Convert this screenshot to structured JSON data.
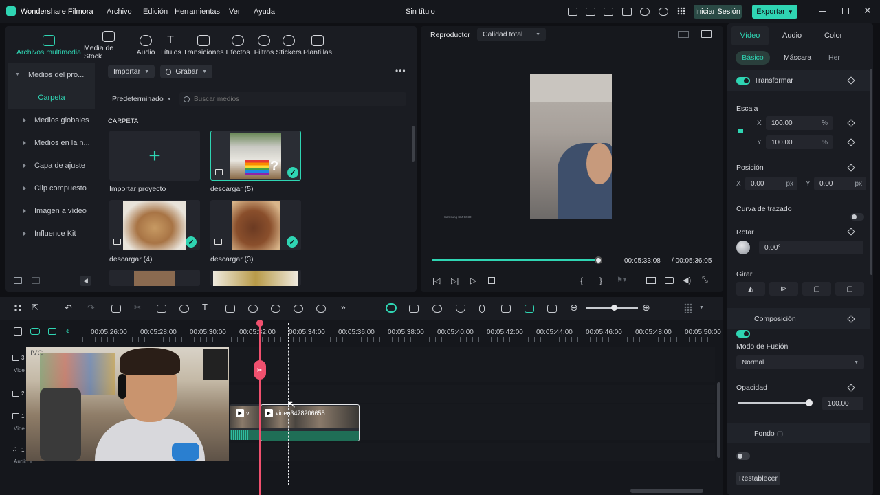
{
  "app": {
    "name": "Wondershare Filmora",
    "doc_title": "Sin título"
  },
  "menu": [
    "Archivo",
    "Edición",
    "Herramientas",
    "Ver",
    "Ayuda"
  ],
  "topbar": {
    "login_label": "Iniciar Sesión",
    "export_label": "Exportar"
  },
  "toolbar": {
    "items": [
      "Archivos multimedia",
      "Media de Stock",
      "Audio",
      "Títulos",
      "Transiciones",
      "Efectos",
      "Filtros",
      "Stickers",
      "Plantillas"
    ],
    "active_index": 0
  },
  "sidebar": {
    "header": "Medios del pro...",
    "folder": "Carpeta",
    "items": [
      "Medios globales",
      "Medios en la n...",
      "Capa de ajuste",
      "Clip compuesto",
      "Imagen a vídeo",
      "Influence Kit"
    ]
  },
  "media": {
    "import_label": "Importar",
    "record_label": "Grabar",
    "sort_label": "Predeterminado",
    "search_placeholder": "Buscar medios",
    "section_label": "CARPETA",
    "import_project_label": "Importar proyecto",
    "items": [
      {
        "name": "descargar (5)",
        "selected": true
      },
      {
        "name": "descargar (4)",
        "selected": false
      },
      {
        "name": "descargar (3)",
        "selected": false
      }
    ]
  },
  "player": {
    "label": "Reproductor",
    "quality": "Calidad total",
    "current_time": "00:05:33:08",
    "total_time": "/ 00:05:36:05",
    "progress": 0.985,
    "watermark": "Samsung SM-G930"
  },
  "inspector": {
    "tabs": [
      "Vídeo",
      "Audio",
      "Color"
    ],
    "active_tab": 0,
    "subtabs": [
      "Básico",
      "Máscara",
      "Her"
    ],
    "transform_label": "Transformar",
    "scale_label": "Escala",
    "scale_x": "100.00",
    "scale_y": "100.00",
    "percent": "%",
    "position_label": "Posición",
    "pos_x": "0.00",
    "pos_y": "0.00",
    "px": "px",
    "x_label": "X",
    "y_label": "Y",
    "curve_label": "Curva de trazado",
    "rotate_label": "Rotar",
    "rotate_value": "0.00°",
    "flip_label": "Girar",
    "composition_label": "Composición",
    "blend_label": "Modo de Fusión",
    "blend_value": "Normal",
    "opacity_label": "Opacidad",
    "opacity_value": "100.00",
    "opacity_level": 1.0,
    "background_label": "Fondo",
    "reset_label": "Restablecer"
  },
  "timeline": {
    "ruler": [
      "00:05:26:00",
      "00:05:28:00",
      "00:05:30:00",
      "00:05:32:00",
      "00:05:34:00",
      "00:05:36:00",
      "00:05:38:00",
      "00:05:40:00",
      "00:05:42:00",
      "00:05:44:00",
      "00:05:46:00",
      "00:05:48:00",
      "00:05:50:00"
    ],
    "tracks": [
      {
        "num": "3",
        "label": "Vide"
      },
      {
        "num": "2",
        "label": ""
      },
      {
        "num": "1",
        "label": "Vide"
      },
      {
        "num": "1",
        "label": "Audio 1"
      }
    ],
    "clips": [
      {
        "name": "vi",
        "track": 1
      },
      {
        "name": "video3478206655",
        "track": 1
      }
    ],
    "overlay_text": "IVC"
  }
}
